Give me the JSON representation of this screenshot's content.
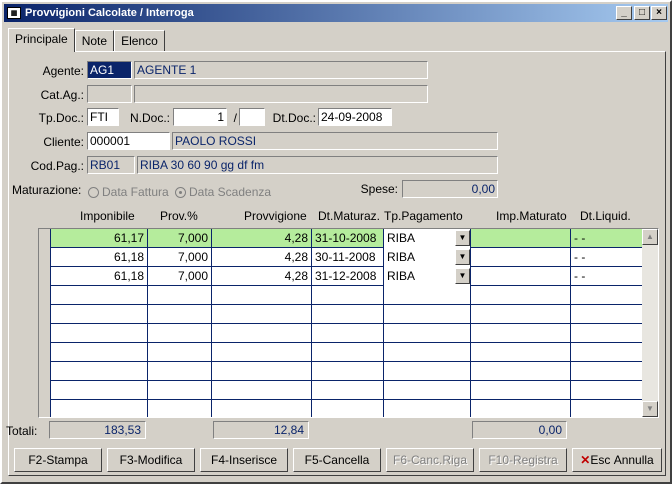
{
  "window": {
    "title": "Provvigioni Calcolate / Interroga"
  },
  "tabs": [
    "Principale",
    "Note",
    "Elenco"
  ],
  "form": {
    "agente_label": "Agente:",
    "agente_code": "AG1",
    "agente_name": "AGENTE 1",
    "catag_label": "Cat.Ag.:",
    "catag_code": "",
    "catag_name": "",
    "tpdoc_label": "Tp.Doc.:",
    "tpdoc_value": "FTI",
    "ndoc_label": "N.Doc.:",
    "ndoc_value": "1",
    "ndoc_sep": "/",
    "ndoc_suffix": "",
    "dtdoc_label": "Dt.Doc.:",
    "dtdoc_value": "24-09-2008",
    "cliente_label": "Cliente:",
    "cliente_code": "000001",
    "cliente_name": "PAOLO ROSSI",
    "codpag_label": "Cod.Pag.:",
    "codpag_code": "RB01",
    "codpag_desc": "RIBA 30 60 90 gg df fm",
    "maturazione_label": "Maturazione:",
    "radio_fattura": "Data Fattura",
    "radio_scadenza": "Data Scadenza",
    "spese_label": "Spese:",
    "spese_value": "0,00"
  },
  "grid": {
    "headers": [
      "Imponibile",
      "Prov.%",
      "Provvigione",
      "Dt.Maturaz.",
      "Tp.Pagamento",
      "Imp.Maturato",
      "Dt.Liquid."
    ],
    "rows": [
      [
        "61,17",
        "7,000",
        "4,28",
        "31-10-2008",
        "RIBA",
        "",
        "- -"
      ],
      [
        "61,18",
        "7,000",
        "4,28",
        "30-11-2008",
        "RIBA",
        "",
        "- -"
      ],
      [
        "61,18",
        "7,000",
        "4,28",
        "31-12-2008",
        "RIBA",
        "",
        "- -"
      ]
    ]
  },
  "totals": {
    "label": "Totali:",
    "imponibile": "183,53",
    "provvigione": "12,84",
    "imp_maturato": "0,00"
  },
  "buttons": {
    "stampa": "F2-Stampa",
    "modifica": "F3-Modifica",
    "inserisce": "F4-Inserisce",
    "cancella": "F5-Cancella",
    "canc_riga": "F6-Canc.Riga",
    "registra": "F10-Registra",
    "esc": "Esc",
    "annulla": "Annulla"
  },
  "colors": {
    "title_bar": "#0a246a",
    "selected_row": "#b5ec9c"
  }
}
